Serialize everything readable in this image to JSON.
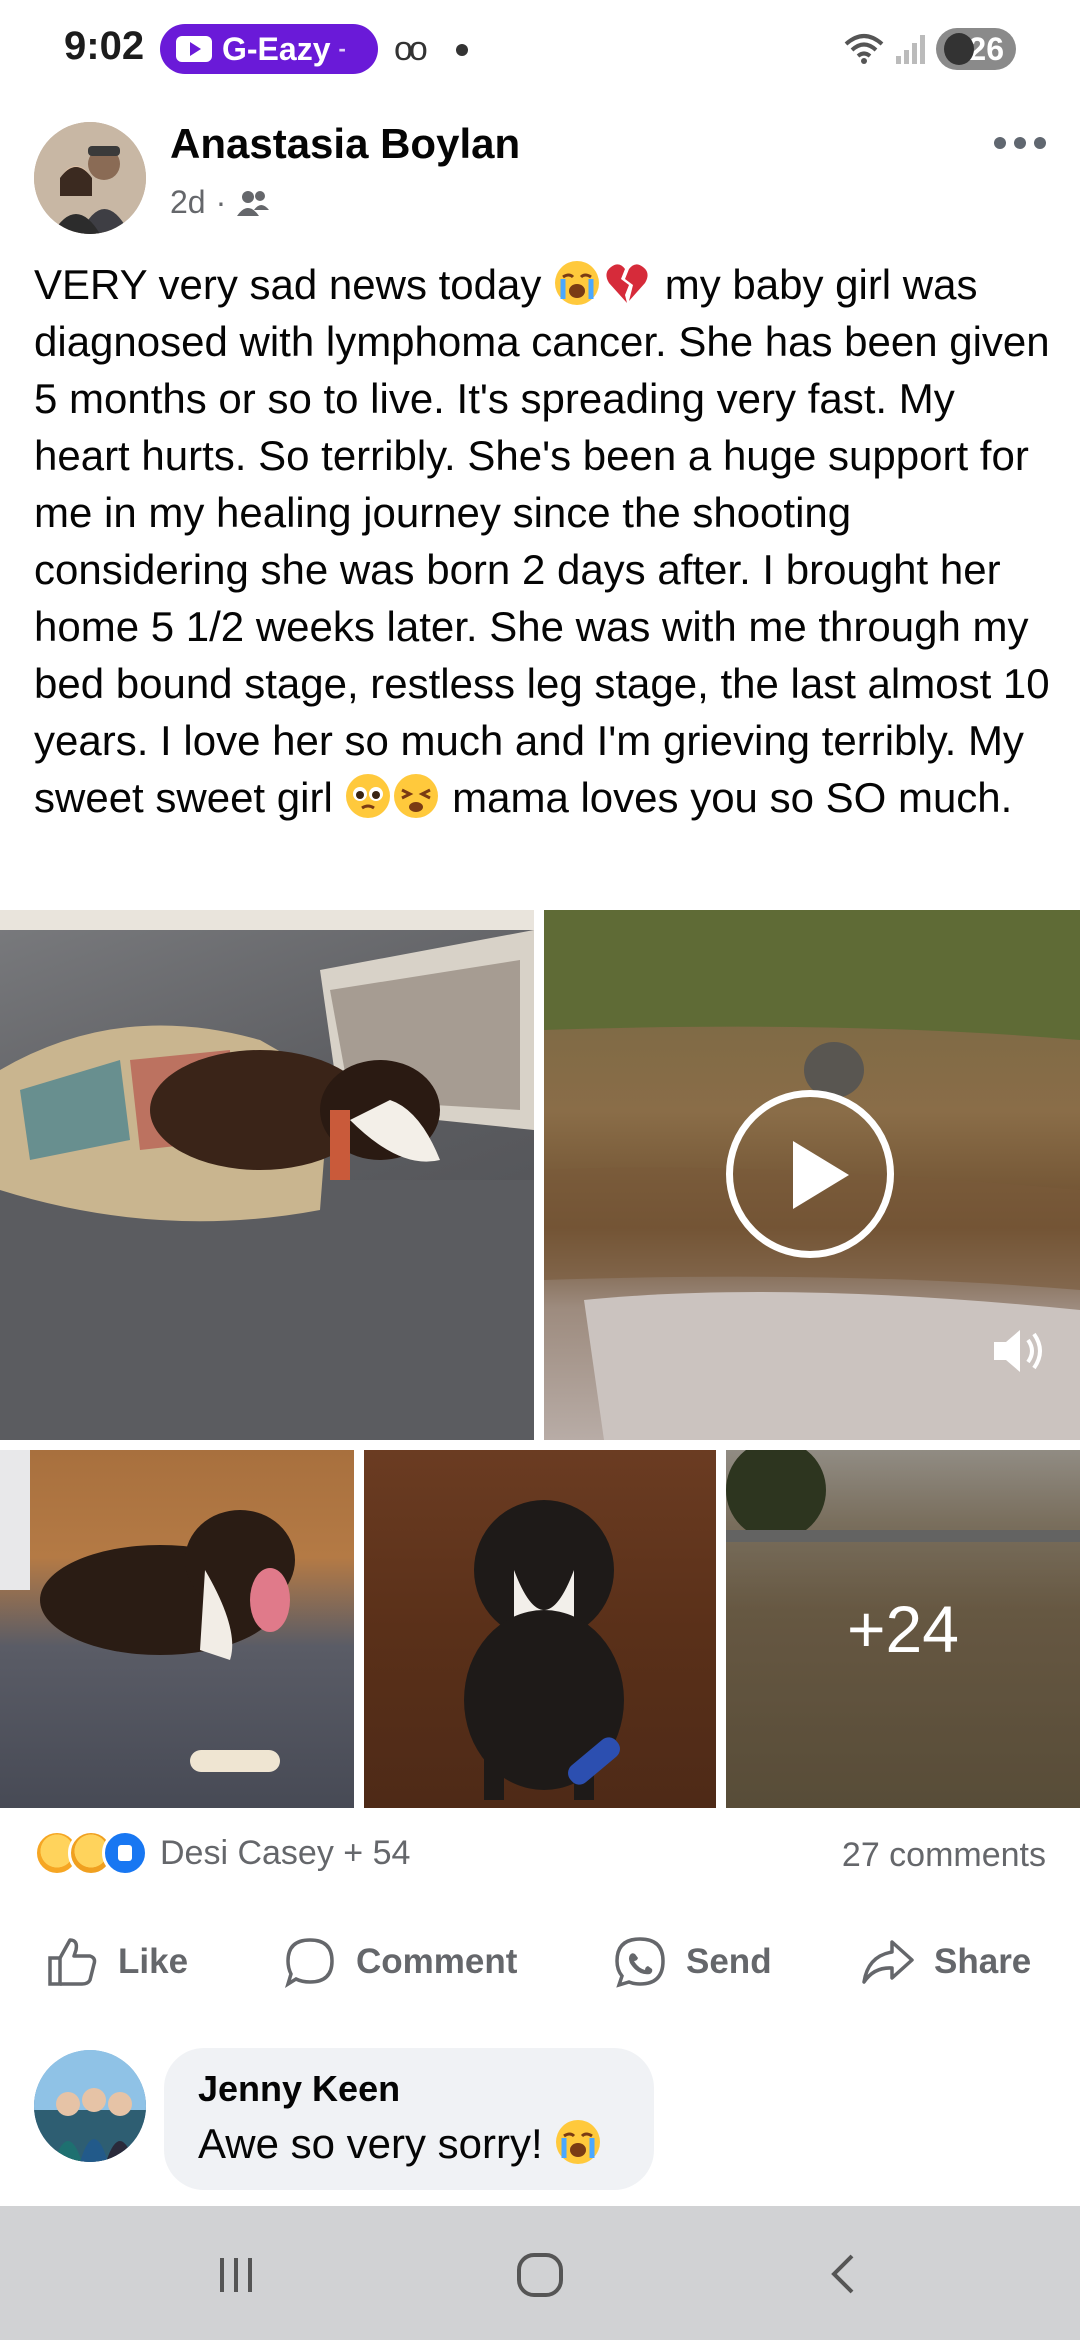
{
  "status_bar": {
    "time": "9:02",
    "media_pill": "G-Eazy",
    "battery": "26"
  },
  "post": {
    "author": "Anastasia Boylan",
    "time": "2d",
    "meta_separator": "·",
    "audience_icon": "friends-icon",
    "text_parts": [
      "VERY very sad news today ",
      " my baby girl was diagnosed with lymphoma cancer. She has been given 5 months or so to live. It's spreading very fast. My heart hurts. So terribly. She's been a huge support for me in my healing journey since the shooting considering she was born 2 days after. I brought her home 5 1/2 weeks later. She was with me through my bed bound stage, restless leg stage, the last almost 10 years. I love her so much and I'm grieving terribly. My sweet sweet girl ",
      " mama loves you so SO much."
    ],
    "more_photos_label": "+24",
    "reactions_summary": "Desi Casey + 54",
    "comments_count": "27 comments"
  },
  "actions": {
    "like": "Like",
    "comment": "Comment",
    "send": "Send",
    "share": "Share"
  },
  "comment": {
    "author": "Jenny Keen",
    "text": "Awe so very sorry! "
  },
  "colors": {
    "pill": "#6a1ad8",
    "secondary_text": "#65676b",
    "bubble": "#f0f2f5",
    "like_blue": "#1877f2",
    "nav_bar": "#d1d2d4"
  }
}
